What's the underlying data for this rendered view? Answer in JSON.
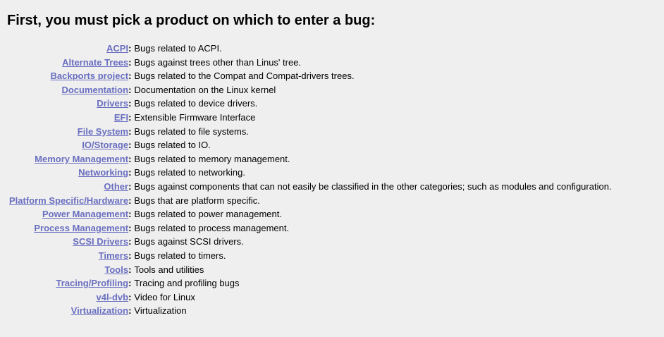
{
  "page": {
    "title": "First, you must pick a product on which to enter a bug:"
  },
  "products": [
    {
      "name": "ACPI",
      "description": "Bugs related to ACPI."
    },
    {
      "name": "Alternate Trees",
      "description": "Bugs against trees other than Linus' tree."
    },
    {
      "name": "Backports project",
      "description": "Bugs related to the Compat and Compat-drivers trees."
    },
    {
      "name": "Documentation",
      "description": "Documentation on the Linux kernel"
    },
    {
      "name": "Drivers",
      "description": "Bugs related to device drivers."
    },
    {
      "name": "EFI",
      "description": "Extensible Firmware Interface"
    },
    {
      "name": "File System",
      "description": "Bugs related to file systems."
    },
    {
      "name": "IO/Storage",
      "description": "Bugs related to IO."
    },
    {
      "name": "Memory Management",
      "description": "Bugs related to memory management."
    },
    {
      "name": "Networking",
      "description": "Bugs related to networking."
    },
    {
      "name": "Other",
      "description": "Bugs against components that can not easily be classified in the other categories; such as modules and configuration."
    },
    {
      "name": "Platform Specific/Hardware",
      "description": "Bugs that are platform specific."
    },
    {
      "name": "Power Management",
      "description": "Bugs related to power management."
    },
    {
      "name": "Process Management",
      "description": "Bugs related to process management."
    },
    {
      "name": "SCSI Drivers",
      "description": "Bugs against SCSI drivers."
    },
    {
      "name": "Timers",
      "description": "Bugs related to timers."
    },
    {
      "name": "Tools",
      "description": "Tools and utilities"
    },
    {
      "name": "Tracing/Profiling",
      "description": "Tracing and profiling bugs"
    },
    {
      "name": "v4l-dvb",
      "description": "Video for Linux"
    },
    {
      "name": "Virtualization",
      "description": "Virtualization"
    }
  ],
  "colors": {
    "background": "#efefef",
    "link": "#6a6fc0",
    "text": "#000000"
  }
}
